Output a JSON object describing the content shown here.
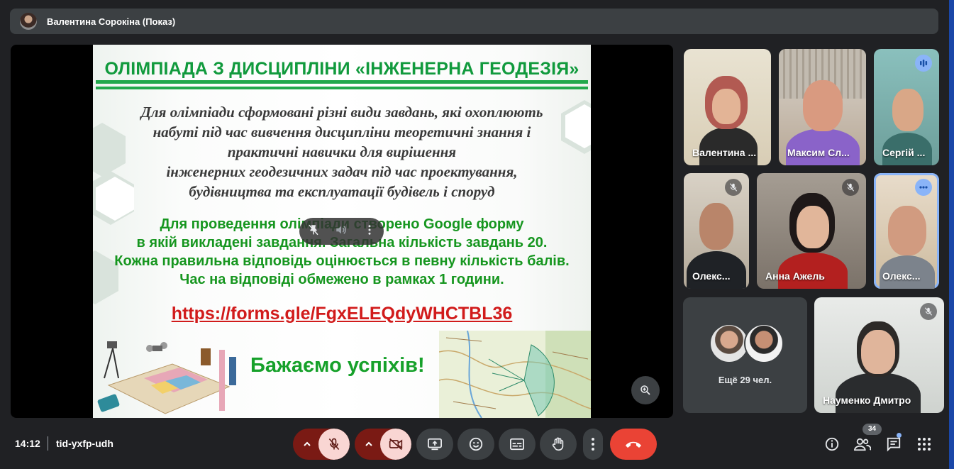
{
  "presenter_bar": {
    "title": "Валентина Сорокіна (Показ)"
  },
  "slide": {
    "title": "ОЛІМПІАДА З ДИСЦИПЛІНИ «ІНЖЕНЕРНА ГЕОДЕЗІЯ»",
    "paragraph1": "Для олімпіади сформовані різні види завдань, які охоплюють\nнабуті під час вивчення дисципліни теоретичні знання і\nпрактичні навички для вирішення\nінженерних геодезичних задач під час проектування,\nбудівництва та експлуатації будівель і споруд",
    "paragraph2": "Для проведення олімпіади створено Google форму\nв якій викладені завдання. Загальна кількість завдань 20.\nКожна правильна відповідь оцінюється в певну кількість балів.\nЧас на відповіді обмежено в рамках 1 години.",
    "link": "https://forms.gle/FgxELEQdyWHCTBL36",
    "wish": "Бажаємо успіхів!"
  },
  "participants": [
    {
      "name": "Валентина ...",
      "muted": false
    },
    {
      "name": "Максим Сл...",
      "muted": false
    },
    {
      "name": "Сергій ...",
      "speaking": true
    },
    {
      "name": "Олекс...",
      "muted": true
    },
    {
      "name": "Анна Ажель",
      "muted": true
    },
    {
      "name": "Олекс...",
      "speaking": true
    },
    {
      "name": "Науменко Дмитро",
      "muted": true
    }
  ],
  "more_tile": {
    "label": "Ещё 29 чел."
  },
  "bottom_bar": {
    "time": "14:12",
    "meeting_code": "tid-yxfp-udh",
    "participants_count": "34"
  },
  "colors": {
    "background": "#202124",
    "tile": "#3c4043",
    "hangup": "#ea4335",
    "muted_button": "#f9d6d3",
    "slide_title": "#119a3d",
    "link": "#d11b1b"
  }
}
